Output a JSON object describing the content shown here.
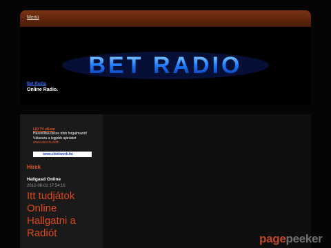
{
  "menu": {
    "label": "Menü"
  },
  "header": {
    "logo_text": "BET RADIO",
    "site_title": "Bet Radio",
    "site_subtitle": "Online Radio."
  },
  "ad": {
    "title": "LID TV eKeze",
    "line1": "Hasonlítsa össze több forgalmazót!",
    "line2": "Válassza a legjobb ajánlatot",
    "url": "www.dssr.hu/edh",
    "banner": "www.ctnetwork.hu"
  },
  "news": {
    "heading": "Hírek",
    "post_title": "Hallgasd Online",
    "post_date": "2012-08-01 17:54:16",
    "post_headline": "Itt tudjátok Online Hallgatni a Radiót"
  },
  "watermark": {
    "part1": "page",
    "part2": "peeker"
  }
}
